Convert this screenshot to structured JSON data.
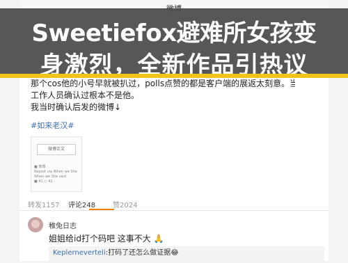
{
  "app": {
    "title": "微博"
  },
  "overlay": {
    "line1": "Sweetiefox避难所女孩变",
    "line2": "身激烈，全新作品引热议"
  },
  "post": {
    "lines": [
      "那个cos他的小号早就被扒过，polls点赞的都是客户端的展返太刻意。当时就跟",
      "工作人员确认过根本不是他。",
      "我当时确认后发的微博↓"
    ],
    "hashtag": "#如来老汉#",
    "card": {
      "button": "微博正文",
      "lines": [
        "■ 微博",
        "Repost via When we She",
        "When we She said ·",
        "■ 41 ○ 42 ·"
      ]
    }
  },
  "tabs": [
    {
      "label": "转发1157",
      "active": false
    },
    {
      "label": "评论248",
      "active": true
    },
    {
      "label": "赞2024",
      "active": false
    }
  ],
  "comment": {
    "user": "稚兔日志",
    "text": "姐姐给id打个码吧 这事不大 🙏",
    "reply_name": "Keplerneverteli",
    "reply_text": ":打码了还怎么做证据😂"
  },
  "colors": {
    "accent": "#f0c419",
    "link": "#3b6fb6",
    "tab_active": "#f08300"
  }
}
